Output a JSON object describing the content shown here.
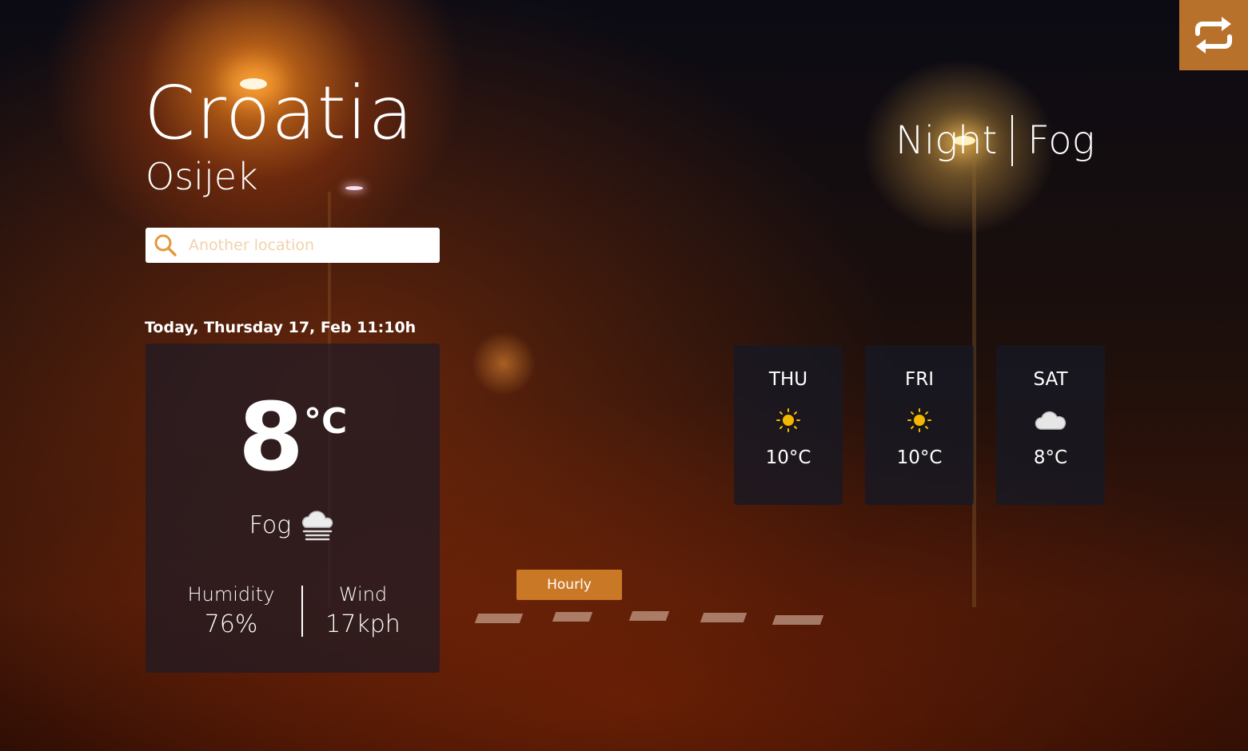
{
  "location": {
    "country": "Croatia",
    "city": "Osijek"
  },
  "search": {
    "placeholder": "Another location",
    "icon": "search-icon"
  },
  "datetime": "Today, Thursday 17, Feb 11:10h",
  "current": {
    "temperature": "8",
    "unit": "°C",
    "condition": "Fog",
    "condition_icon": "fog-icon",
    "humidity_label": "Humidity",
    "humidity_value": "76%",
    "wind_label": "Wind",
    "wind_value": "17kph"
  },
  "summary": {
    "time_of_day": "Night",
    "condition": "Fog"
  },
  "forecast": [
    {
      "day": "THU",
      "icon": "sun-icon",
      "temp": "10°C"
    },
    {
      "day": "FRI",
      "icon": "sun-icon",
      "temp": "10°C"
    },
    {
      "day": "SAT",
      "icon": "cloud-icon",
      "temp": "8°C"
    }
  ],
  "hourly_button": "Hourly",
  "toggle_button_icon": "repeat-icon",
  "colors": {
    "accent": "#c97825",
    "toggle_bg": "#b8712a",
    "sun": "#f5b800",
    "card_bg": "#1e1a26"
  }
}
